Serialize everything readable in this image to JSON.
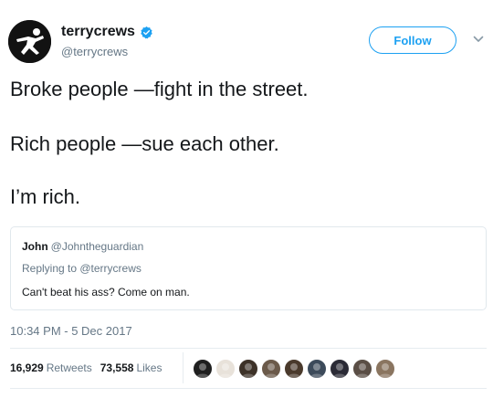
{
  "author": {
    "display_name": "terrycrews",
    "handle": "@terrycrews",
    "verified": true,
    "avatar_icon": "running-figure-avatar"
  },
  "header": {
    "follow_label": "Follow",
    "menu_icon": "chevron-down-icon"
  },
  "tweet": {
    "lines": [
      "Broke people —fight in the street.",
      "Rich people —sue each other.",
      "I’m rich."
    ]
  },
  "quoted_tweet": {
    "name": "John",
    "handle": "@Johntheguardian",
    "reply_context": "Replying to @terrycrews",
    "text": "Can't beat his ass? Come on man."
  },
  "timestamp": "10:34 PM - 5 Dec 2017",
  "stats": {
    "retweets_count": "16,929",
    "retweets_label": "Retweets",
    "likes_count": "73,558",
    "likes_label": "Likes"
  },
  "likers": [
    {
      "color": "#1f1f1f"
    },
    {
      "color": "#e8e2da"
    },
    {
      "color": "#3d3228"
    },
    {
      "color": "#6b5a4a"
    },
    {
      "color": "#4a3a2c"
    },
    {
      "color": "#3c4a5a"
    },
    {
      "color": "#2b2b36"
    },
    {
      "color": "#5a4e45"
    },
    {
      "color": "#8a7560"
    }
  ],
  "colors": {
    "accent": "#1da1f2",
    "text_primary": "#14171a",
    "text_secondary": "#657786",
    "border": "#e1e8ed"
  }
}
